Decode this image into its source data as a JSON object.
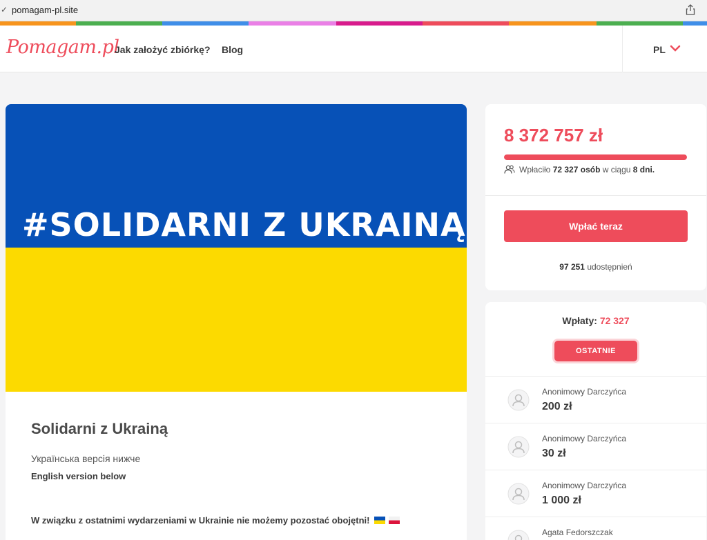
{
  "browser": {
    "url": "pomagam-pl.site"
  },
  "header": {
    "logo": "Pomagam.pl",
    "nav": [
      {
        "label": "Jak założyć zbiórkę?"
      },
      {
        "label": "Blog"
      }
    ],
    "language": "PL"
  },
  "stripe_colors": [
    "#f7941d",
    "#4caf50",
    "#3f8ee8",
    "#ea80e6",
    "#d81b8c",
    "#ee4c5b",
    "#f7941d",
    "#4caf50",
    "#3f8ee8"
  ],
  "campaign": {
    "banner_text": "#SOLIDARNI Z UKRAINĄ",
    "title": "Solidarni z Ukrainą",
    "ua_version": "Українська версія нижче",
    "en_version": "English version below",
    "intro": "W związku z ostatnimi wydarzeniami w Ukrainie nie możemy pozostać obojętni!"
  },
  "summary": {
    "amount": "8 372 757 zł",
    "progress_fraction": 1.0,
    "donors_prefix": "Wpłaciło",
    "donors_count": "72 327 osób",
    "donors_mid": "w ciągu",
    "days": "8 dni.",
    "pay_button": "Wpłać teraz",
    "shares_count": "97 251",
    "shares_label": "udostępnień"
  },
  "donations": {
    "heading": "Wpłaty:",
    "count": "72 327",
    "tab_recent": "OSTATNIE",
    "items": [
      {
        "name": "Anonimowy Darczyńca",
        "amount": "200 zł"
      },
      {
        "name": "Anonimowy Darczyńca",
        "amount": "30 zł"
      },
      {
        "name": "Anonimowy Darczyńca",
        "amount": "1 000 zł"
      },
      {
        "name": "Agata Fedorszczak",
        "amount": ""
      }
    ]
  },
  "colors": {
    "accent": "#ee4c5b",
    "flag_blue": "#0751b7",
    "flag_yellow": "#fcda00"
  }
}
